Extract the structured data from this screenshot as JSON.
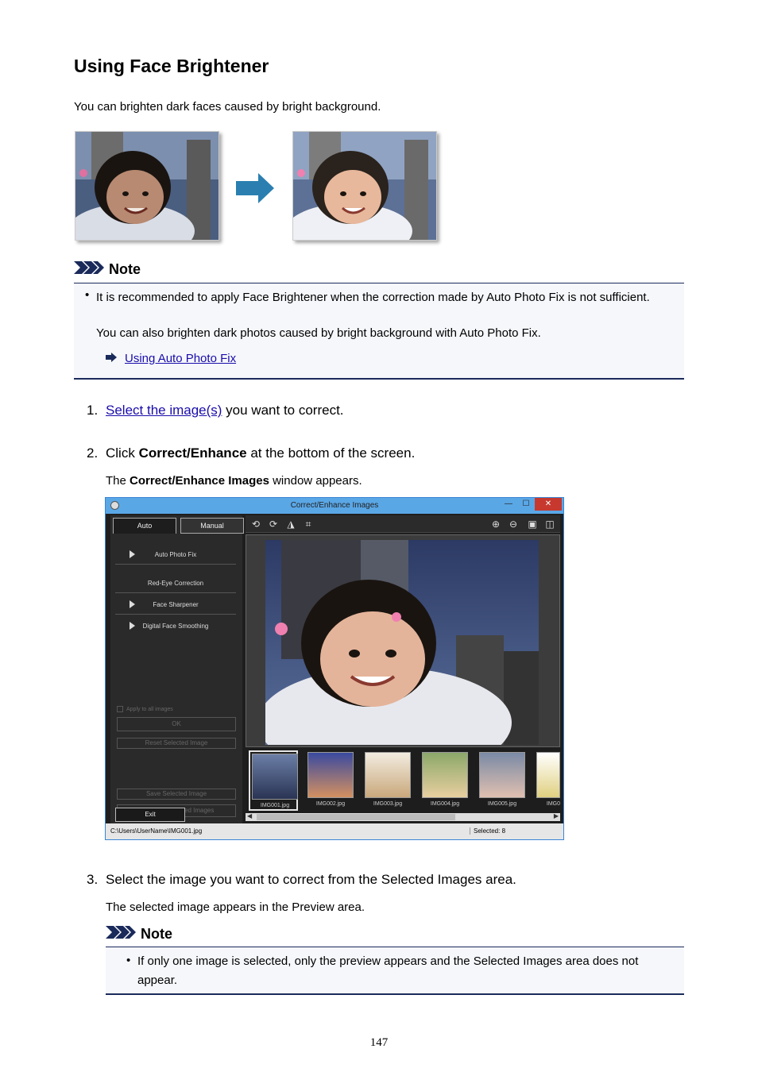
{
  "title": "Using Face Brightener",
  "intro": "You can brighten dark faces caused by bright background.",
  "note1": {
    "heading": "Note",
    "bullet_line1": "It is recommended to apply Face Brightener when the correction made by Auto Photo Fix is not sufficient.",
    "bullet_line2": "You can also brighten dark photos caused by bright background with Auto Photo Fix.",
    "link": "Using Auto Photo Fix"
  },
  "steps": [
    {
      "num": "1.",
      "link": "Select the image(s)",
      "text": " you want to correct."
    },
    {
      "num": "2.",
      "pre": "Click ",
      "bold": "Correct/Enhance",
      "post": " at the bottom of the screen.",
      "sub_pre": "The ",
      "sub_bold": "Correct/Enhance Images",
      "sub_post": " window appears."
    },
    {
      "num": "3.",
      "text": "Select the image you want to correct from the Selected Images area.",
      "sub": "The selected image appears in the Preview area."
    }
  ],
  "window": {
    "title": "Correct/Enhance Images",
    "min": "—",
    "max": "☐",
    "close": "✕",
    "tabs": [
      "Auto",
      "Manual"
    ],
    "menu": [
      "Auto Photo Fix",
      "Red-Eye Correction",
      "Face Sharpener",
      "Digital Face Smoothing"
    ],
    "apply_all": "Apply to all images",
    "ok": "OK",
    "reset": "Reset Selected Image",
    "save_selected": "Save Selected Image",
    "save_all": "Save All Corrected Images",
    "exit": "Exit",
    "thumbs": [
      "IMG001.jpg",
      "IMG002.jpg",
      "IMG003.jpg",
      "IMG004.jpg",
      "IMG005.jpg",
      "IMG0"
    ],
    "path": "C:\\Users\\UserName\\IMG001.jpg",
    "selected": "Selected: 8"
  },
  "note2": {
    "heading": "Note",
    "bullet": "If only one image is selected, only the preview appears and the Selected Images area does not appear."
  },
  "page_number": "147",
  "colors": {
    "link": "#1a0dab",
    "note_rule": "#1a2a5a",
    "arrow": "#2a7fb0"
  }
}
